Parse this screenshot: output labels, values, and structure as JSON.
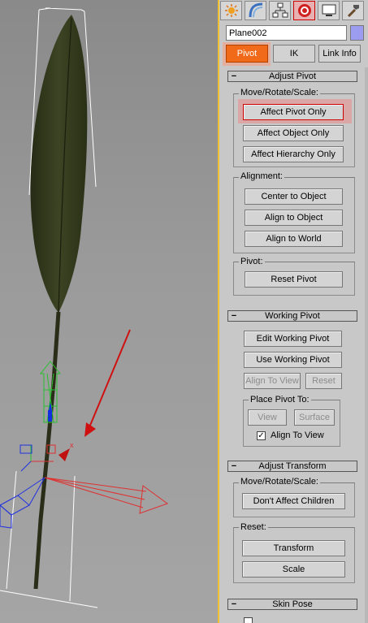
{
  "toolbar_tabs": [
    {
      "name": "create-icon",
      "active": false
    },
    {
      "name": "modify-icon",
      "active": false
    },
    {
      "name": "hierarchy-icon",
      "active": true
    },
    {
      "name": "motion-icon",
      "active": false
    },
    {
      "name": "display-icon",
      "active": false
    },
    {
      "name": "utilities-icon",
      "active": false
    }
  ],
  "object": {
    "name": "Plane002",
    "color": "#9c9cf0"
  },
  "subtabs": {
    "pivot": "Pivot",
    "ik": "IK",
    "link_info": "Link Info"
  },
  "adjust_pivot": {
    "title": "Adjust Pivot",
    "move_group": "Move/Rotate/Scale:",
    "affect_pivot_only": "Affect Pivot Only",
    "affect_object_only": "Affect Object Only",
    "affect_hierarchy_only": "Affect Hierarchy Only",
    "alignment_group": "Alignment:",
    "center_to_object": "Center to Object",
    "align_to_object": "Align to Object",
    "align_to_world": "Align to World",
    "pivot_group": "Pivot:",
    "reset_pivot": "Reset Pivot"
  },
  "working_pivot": {
    "title": "Working Pivot",
    "edit_working_pivot": "Edit Working Pivot",
    "use_working_pivot": "Use Working Pivot",
    "align_to_view": "Align To View",
    "reset": "Reset",
    "place_group": "Place Pivot To:",
    "view": "View",
    "surface": "Surface",
    "align_to_view_check": "Align To View",
    "align_to_view_checked": true
  },
  "adjust_transform": {
    "title": "Adjust Transform",
    "move_group": "Move/Rotate/Scale:",
    "dont_affect_children": "Don't Affect Children",
    "reset_group": "Reset:",
    "transform": "Transform",
    "scale": "Scale"
  },
  "skin_pose": {
    "title": "Skin Pose"
  },
  "viewport": {
    "axis_label": "x"
  }
}
